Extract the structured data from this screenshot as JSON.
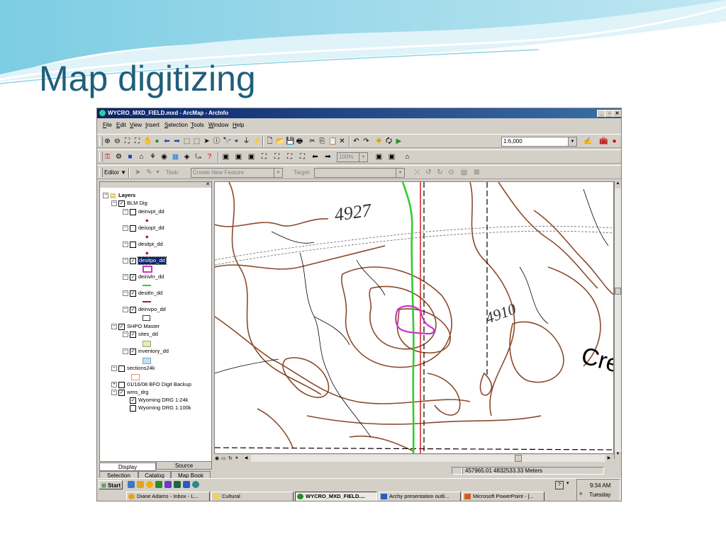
{
  "slide": {
    "title": "Map digitizing"
  },
  "window": {
    "title": "WYCRO_MXD_FIELD.mxd - ArcMap - ArcInfo"
  },
  "menu": [
    "File",
    "Edit",
    "View",
    "Insert",
    "Selection",
    "Tools",
    "Window",
    "Help"
  ],
  "toolbar": {
    "scale": "1:6,000",
    "zoom_percent": "100%"
  },
  "editor": {
    "editor_label": "Editor",
    "task_label": "Task:",
    "task_value": "Create New Feature",
    "target_label": "Target:",
    "target_value": ""
  },
  "toc": {
    "root": "Layers",
    "group1": "BLM Dig",
    "layers1": [
      {
        "name": "deinvpt_dd",
        "checked": false
      },
      {
        "name": "deisopt_dd",
        "checked": false
      },
      {
        "name": "desitpt_dd",
        "checked": false
      },
      {
        "name": "desitpo_dd",
        "checked": true
      },
      {
        "name": "deinvln_dd",
        "checked": true
      },
      {
        "name": "desitln_dd",
        "checked": true
      },
      {
        "name": "deinvpo_dd",
        "checked": true
      }
    ],
    "group2": "SHPO Master",
    "layers2": [
      {
        "name": "sites_dd",
        "checked": true
      },
      {
        "name": "inventory_dd",
        "checked": true
      }
    ],
    "sections": "sections24k",
    "backup": "01/16/08 BFO Digit Backup",
    "wms": "wms_drg",
    "drg1": "Wyoming DRG 1:24k",
    "drg2": "Wyoming DRG 1:100k"
  },
  "tabs": {
    "display": "Display",
    "source": "Source",
    "selection": "Selection",
    "catalog": "Catalog",
    "mapbook": "Map Book"
  },
  "map_labels": {
    "elev_top": "4927",
    "creek": "Cre",
    "elev_right": "4910"
  },
  "status": {
    "coordinates": "457965.01  4832533.33 Meters"
  },
  "taskbar": {
    "start": "Start",
    "items": [
      "Diane Adams - Inbox - L...",
      "Cultural",
      "WYCRO_MXD_FIELD....",
      "Archy presentation outli...",
      "Microsoft PowerPoint - [..."
    ],
    "time": "9:34 AM",
    "day": "Tuesday"
  },
  "colors": {
    "title": "#1f5f7a",
    "contour": "#8b4a2b",
    "green_line": "#33cc33",
    "magenta": "#cc33cc",
    "red_line": "#cc2222"
  }
}
